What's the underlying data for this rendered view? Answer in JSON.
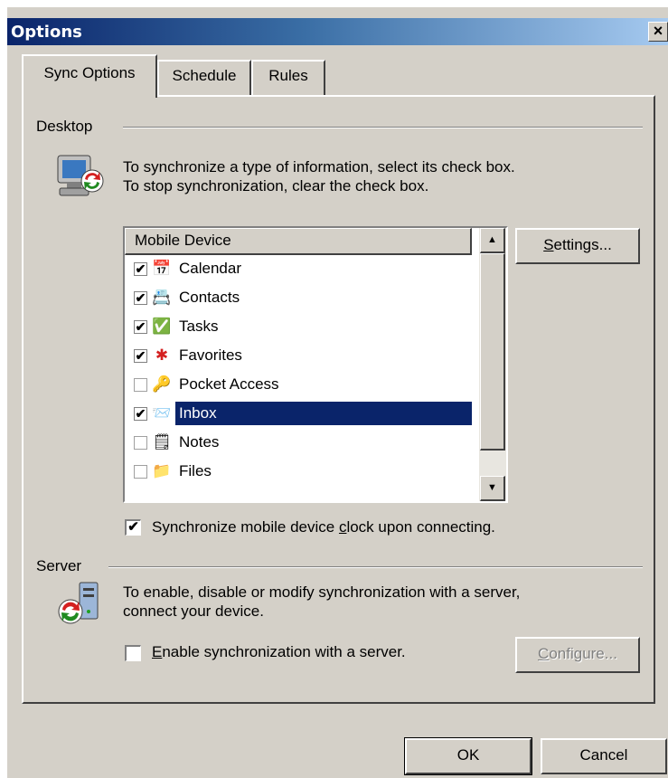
{
  "window": {
    "title": "Options",
    "close_glyph": "×"
  },
  "tabs": [
    {
      "label": "Sync Options",
      "active": true
    },
    {
      "label": "Schedule",
      "active": false
    },
    {
      "label": "Rules",
      "active": false
    }
  ],
  "desktop": {
    "section_label": "Desktop",
    "description_line1": "To synchronize a type of information, select its check box.",
    "description_line2": "To stop synchronization, clear the check box.",
    "icon": "desktop-sync-icon",
    "list_header": "Mobile Device",
    "items": [
      {
        "label": "Calendar",
        "checked": true,
        "icon": "calendar-icon",
        "selected": false
      },
      {
        "label": "Contacts",
        "checked": true,
        "icon": "contacts-icon",
        "selected": false
      },
      {
        "label": "Tasks",
        "checked": true,
        "icon": "tasks-icon",
        "selected": false
      },
      {
        "label": "Favorites",
        "checked": true,
        "icon": "favorites-icon",
        "selected": false
      },
      {
        "label": "Pocket Access",
        "checked": false,
        "icon": "pocket-access-icon",
        "selected": false
      },
      {
        "label": "Inbox",
        "checked": true,
        "icon": "inbox-icon",
        "selected": true
      },
      {
        "label": "Notes",
        "checked": false,
        "icon": "notes-icon",
        "selected": false
      },
      {
        "label": "Files",
        "checked": false,
        "icon": "files-icon",
        "selected": false
      }
    ],
    "settings_button": {
      "before": "",
      "accel": "S",
      "after": "ettings..."
    },
    "clock_sync": {
      "checked": true,
      "before": "Synchronize mobile device ",
      "accel": "c",
      "after": "lock upon connecting."
    }
  },
  "server": {
    "section_label": "Server",
    "description_line1": "To enable, disable or modify synchronization with a server,",
    "description_line2": "connect your device.",
    "icon": "server-sync-icon",
    "enable_sync": {
      "checked": false,
      "before": "",
      "accel": "E",
      "after": "nable synchronization with a server."
    },
    "configure_button": {
      "before": "",
      "accel": "C",
      "after": "onfigure...",
      "disabled": true
    }
  },
  "footer": {
    "ok_label": "OK",
    "cancel_label": "Cancel"
  },
  "colors": {
    "title_start": "#0a246a",
    "title_end": "#a6caf0",
    "selection": "#0a246a",
    "face": "#d4d0c8"
  }
}
